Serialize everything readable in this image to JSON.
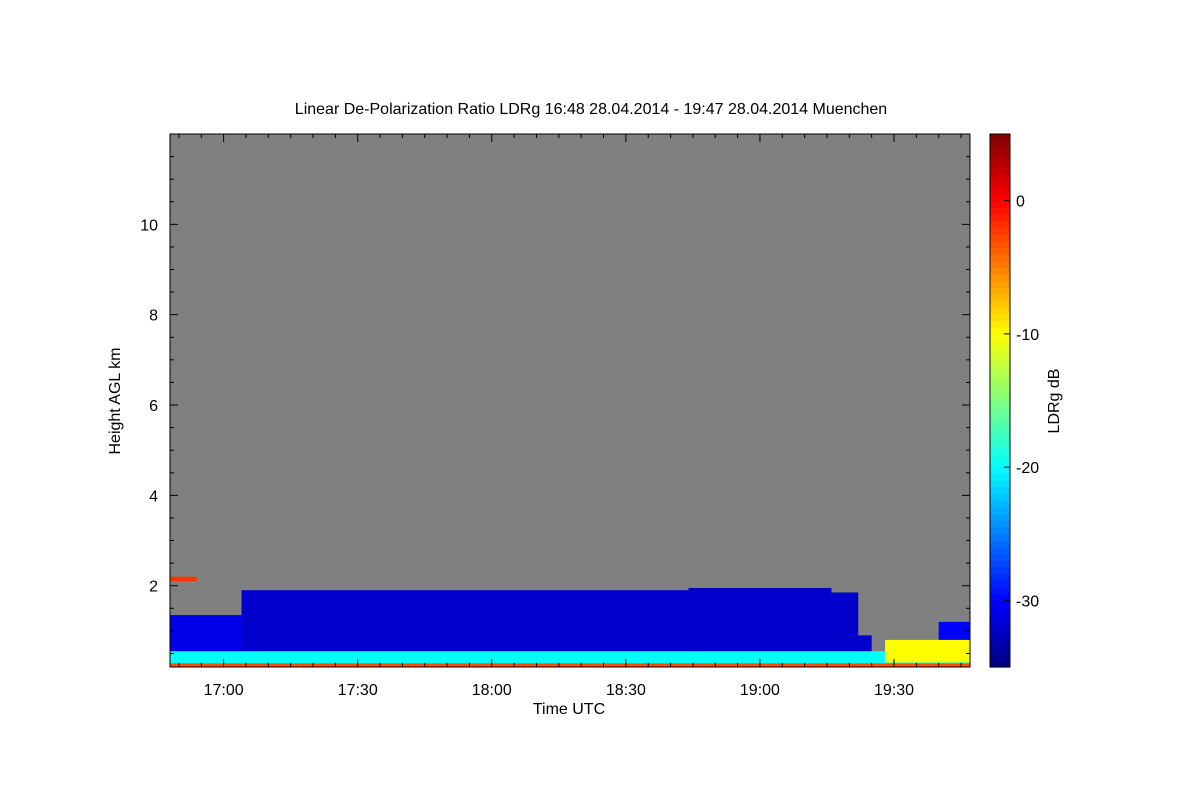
{
  "chart_data": {
    "type": "heatmap",
    "title": "Linear De-Polarization Ratio LDRg   16:48 28.04.2014 - 19:47 28.04.2014 Muenchen",
    "xlabel": "Time UTC",
    "ylabel": "Height AGL km",
    "colorbar_label": "LDRg dB",
    "x_range_min": [
      1008,
      1187
    ],
    "y_range_km": [
      0.2,
      12.0
    ],
    "x_ticks": [
      {
        "min": 1020,
        "label": "17:00"
      },
      {
        "min": 1050,
        "label": "17:30"
      },
      {
        "min": 1080,
        "label": "18:00"
      },
      {
        "min": 1110,
        "label": "18:30"
      },
      {
        "min": 1140,
        "label": "19:00"
      },
      {
        "min": 1170,
        "label": "19:30"
      }
    ],
    "y_ticks": [
      {
        "km": 2,
        "label": "2"
      },
      {
        "km": 4,
        "label": "4"
      },
      {
        "km": 6,
        "label": "6"
      },
      {
        "km": 8,
        "label": "8"
      },
      {
        "km": 10,
        "label": "10"
      }
    ],
    "colorbar_range_db": [
      -35,
      5
    ],
    "colorbar_ticks": [
      {
        "db": 0,
        "label": "0"
      },
      {
        "db": -10,
        "label": "-10"
      },
      {
        "db": -20,
        "label": "-20"
      },
      {
        "db": -30,
        "label": "-30"
      }
    ],
    "colormap": "jet",
    "missing_color": "#808080",
    "regions": [
      {
        "t0": 1008,
        "t1": 1187,
        "h0": 0.2,
        "h1": 12.0,
        "ldr_db": null
      },
      {
        "t0": 1008,
        "t1": 1024,
        "h0": 0.3,
        "h1": 1.35,
        "ldr_db": -31
      },
      {
        "t0": 1024,
        "t1": 1124,
        "h0": 0.3,
        "h1": 1.9,
        "ldr_db": -32
      },
      {
        "t0": 1124,
        "t1": 1156,
        "h0": 0.3,
        "h1": 1.95,
        "ldr_db": -32
      },
      {
        "t0": 1156,
        "t1": 1162,
        "h0": 0.9,
        "h1": 1.85,
        "ldr_db": -32
      },
      {
        "t0": 1156,
        "t1": 1165,
        "h0": 0.3,
        "h1": 0.9,
        "ldr_db": -32
      },
      {
        "t0": 1180,
        "t1": 1187,
        "h0": 0.3,
        "h1": 1.2,
        "ldr_db": -30
      },
      {
        "t0": 1008,
        "t1": 1187,
        "h0": 0.25,
        "h1": 0.55,
        "ldr_db": -20
      },
      {
        "t0": 1008,
        "t1": 1187,
        "h0": 0.2,
        "h1": 0.28,
        "ldr_db": -3
      },
      {
        "t0": 1008,
        "t1": 1014,
        "h0": 2.1,
        "h1": 2.2,
        "ldr_db": -2
      },
      {
        "t0": 1168,
        "t1": 1187,
        "h0": 0.3,
        "h1": 0.8,
        "ldr_db": -10
      }
    ]
  },
  "colors": {
    "no_data": "#808080",
    "axis": "#000000",
    "background": "#ffffff"
  }
}
